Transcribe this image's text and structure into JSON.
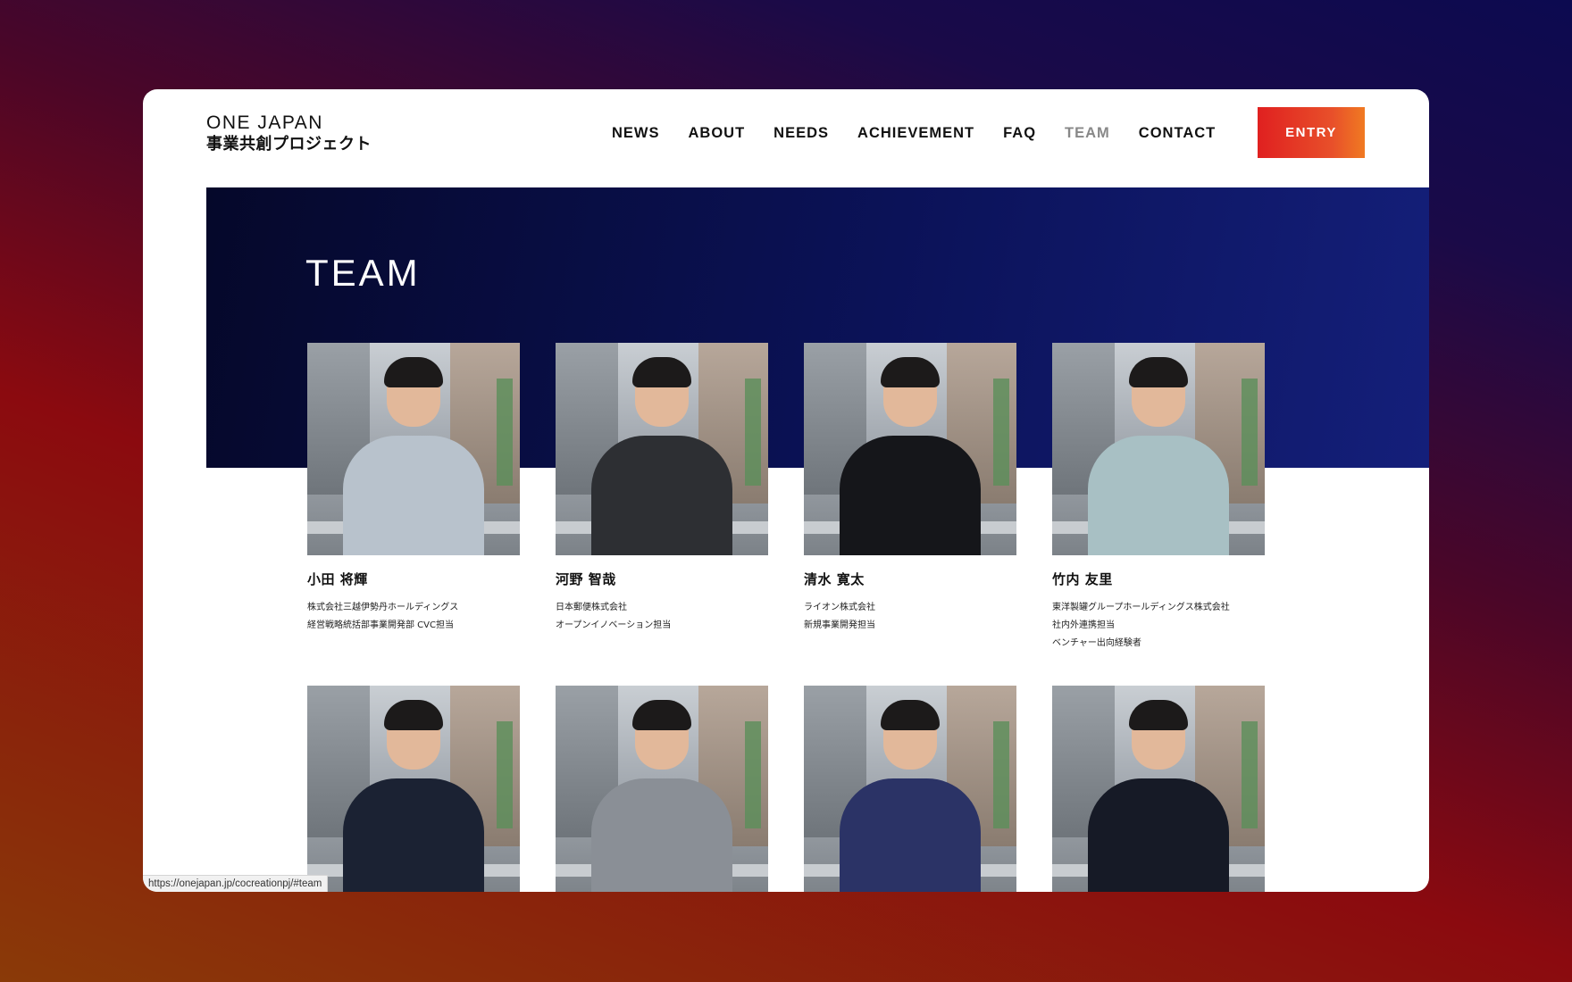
{
  "logo": {
    "en": "ONE JAPAN",
    "jp": "事業共創プロジェクト"
  },
  "nav": [
    {
      "label": "NEWS",
      "active": false
    },
    {
      "label": "ABOUT",
      "active": false
    },
    {
      "label": "NEEDS",
      "active": false
    },
    {
      "label": "ACHIEVEMENT",
      "active": false
    },
    {
      "label": "FAQ",
      "active": false
    },
    {
      "label": "TEAM",
      "active": true
    },
    {
      "label": "CONTACT",
      "active": false
    }
  ],
  "entry_label": "ENTRY",
  "hero_title": "TEAM",
  "members": [
    {
      "name": "小田 将輝",
      "lines": [
        "株式会社三越伊勢丹ホールディングス",
        "経営戦略統括部事業開発部 CVC担当"
      ],
      "clothing": "#b8c2cc"
    },
    {
      "name": "河野 智哉",
      "lines": [
        "日本郵便株式会社",
        "オープンイノベーション担当"
      ],
      "clothing": "#2d2f33"
    },
    {
      "name": "清水 寛太",
      "lines": [
        "ライオン株式会社",
        "新規事業開発担当"
      ],
      "clothing": "#15161a"
    },
    {
      "name": "竹内 友里",
      "lines": [
        "東洋製罐グループホールディングス株式会社",
        "社内外連携担当",
        "ベンチャー出向経験者"
      ],
      "clothing": "#a8c0c4"
    },
    {
      "name": "",
      "lines": [],
      "clothing": "#1b2233"
    },
    {
      "name": "",
      "lines": [],
      "clothing": "#8a8f96"
    },
    {
      "name": "",
      "lines": [],
      "clothing": "#2b3366"
    },
    {
      "name": "",
      "lines": [],
      "clothing": "#161a26"
    }
  ],
  "status_url": "https://onejapan.jp/cocreationpj/#team"
}
